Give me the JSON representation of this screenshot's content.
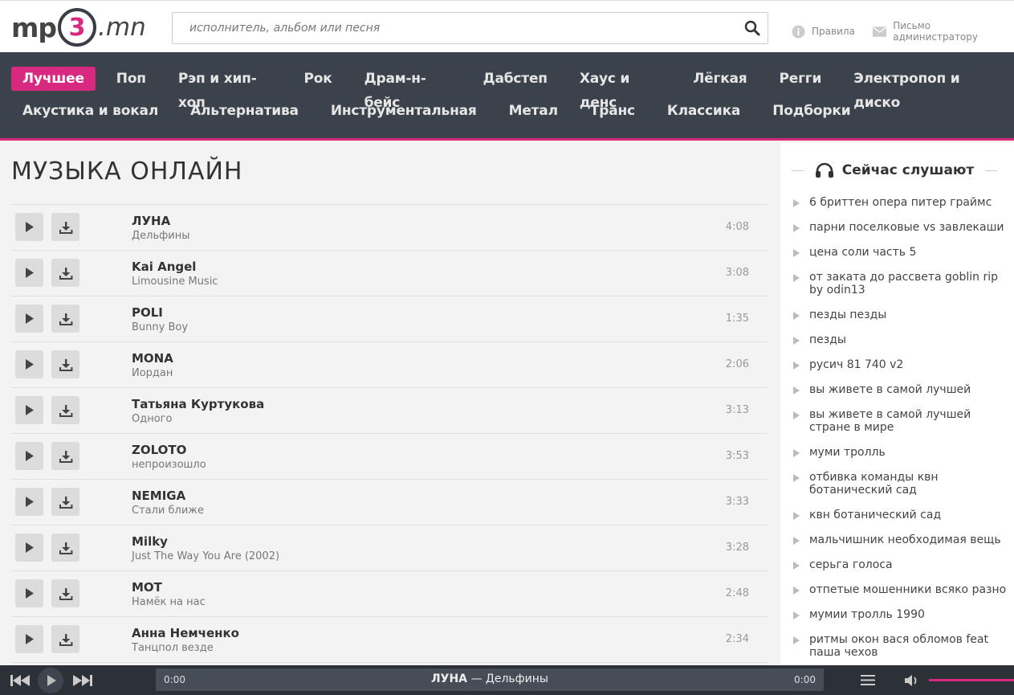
{
  "site": {
    "logo_left": "mp",
    "logo_digit": "3",
    "logo_right": ".mn"
  },
  "search": {
    "placeholder": "исполнитель, альбом или песня",
    "icon": "search-icon"
  },
  "toplinks": [
    {
      "label": "Правила",
      "icon": "info-icon"
    },
    {
      "label": "Письмо администратору",
      "icon": "mail-icon"
    }
  ],
  "nav": {
    "row1": [
      "Лучшее",
      "Поп",
      "Рэп и хип-хоп",
      "Рок",
      "Драм-н-бейс",
      "Дабстеп",
      "Хаус и денс",
      "Лёгкая",
      "Регги",
      "Электропоп и диско"
    ],
    "row2": [
      "Акустика и вокал",
      "Альтернатива",
      "Инструментальная",
      "Метал",
      "Транс",
      "Классика",
      "Подборки"
    ],
    "active": "Лучшее",
    "accent": "#d6297f"
  },
  "main": {
    "title": "МУЗЫКА ОНЛАЙН",
    "tracks": [
      {
        "artist": "ЛУНА",
        "title": "Дельфины",
        "duration": "4:08"
      },
      {
        "artist": "Kai Angel",
        "title": "Limousine Music",
        "duration": "3:08"
      },
      {
        "artist": "POLI",
        "title": "Bunny Boy",
        "duration": "1:35"
      },
      {
        "artist": "MONA",
        "title": "Иордан",
        "duration": "2:06"
      },
      {
        "artist": "Татьяна Куртукова",
        "title": "Одного",
        "duration": "3:13"
      },
      {
        "artist": "ZOLOTO",
        "title": "непроизошло",
        "duration": "3:53"
      },
      {
        "artist": "NEMIGA",
        "title": "Стали ближе",
        "duration": "3:33"
      },
      {
        "artist": "Milky",
        "title": "Just The Way You Are (2002)",
        "duration": "3:28"
      },
      {
        "artist": "MOT",
        "title": "Намёк на нас",
        "duration": "2:48"
      },
      {
        "artist": "Анна Немченко",
        "title": "Танцпол везде",
        "duration": "2:34"
      }
    ]
  },
  "sidebar": {
    "title": "Сейчас слушают",
    "icon": "headphones-icon",
    "items": [
      "6 бриттен опера питер граймс",
      "парни поселковые vs завлекаши",
      "цена соли часть 5",
      "от заката до рассвета goblin rip by odin13",
      "пезды пезды",
      "пезды",
      "русич 81 740 v2",
      "вы живете в самой лучшей",
      "вы живете в самой лучшей стране в мире",
      "муми тролль",
      "отбивка команды квн ботанический сад",
      "квн ботанический сад",
      "мальчишник необходимая вещь",
      "серьга голоса",
      "отпетые мошенники всяко разно",
      "мумии тролль 1990",
      "ритмы окон вася обломов feat паша чехов"
    ]
  },
  "player": {
    "current_time": "0:00",
    "total_time": "0:00",
    "now_artist": "ЛУНА",
    "now_sep": " — ",
    "now_title": "Дельфины",
    "volume": 1.0
  }
}
